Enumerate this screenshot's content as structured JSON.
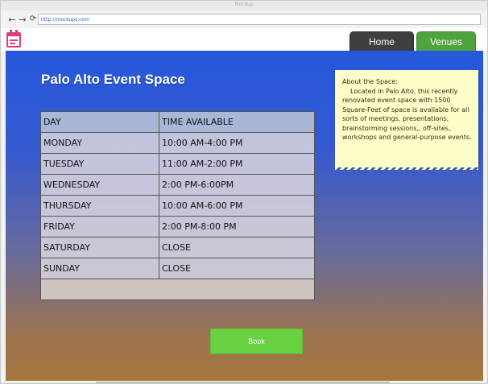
{
  "window": {
    "title": "Mockup"
  },
  "browser": {
    "url": "http://mockups.com"
  },
  "app": {
    "icon": "calendar-icon"
  },
  "tabs": [
    {
      "label": "Home"
    },
    {
      "label": "Venues"
    }
  ],
  "page": {
    "title": "Palo Alto Event Space"
  },
  "schedule": {
    "headers": [
      "DAY",
      "TIME AVAILABLE"
    ],
    "rows": [
      {
        "day": "MONDAY",
        "time": "10:00 AM-4:00 PM"
      },
      {
        "day": "TUESDAY",
        "time": "11:00 AM-2:00 PM"
      },
      {
        "day": "WEDNESDAY",
        "time": "2:00 PM-6:00PM"
      },
      {
        "day": "THURSDAY",
        "time": "10:00 AM-6:00 PM"
      },
      {
        "day": "FRIDAY",
        "time": "2:00 PM-8:00 PM"
      },
      {
        "day": "SATURDAY",
        "time": "CLOSE"
      },
      {
        "day": "SUNDAY",
        "time": "CLOSE"
      }
    ]
  },
  "book_button": {
    "label": "Book"
  },
  "note": {
    "title": "About the Space:",
    "body": "Located in Palo Alto, this recently renovated event space with 1500 Square-Feet of space is available for all sorts of meetings, presentations, brainstorming sessions,, off-sites, workshops and general-purpose events."
  },
  "colors": {
    "home_tab": "#3f3f3f",
    "venues_tab": "#4fa33f",
    "book_button": "#68d243",
    "note_bg": "#fdfdc7",
    "content_top": "#2558dc",
    "content_bottom": "#a5763e"
  }
}
